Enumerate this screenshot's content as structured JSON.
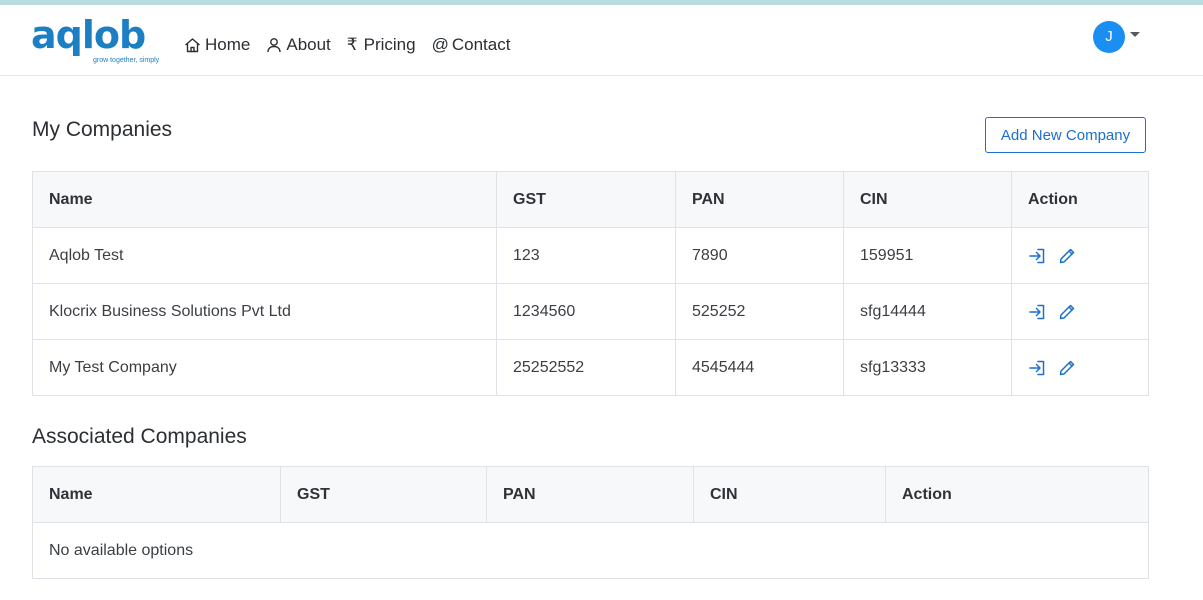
{
  "brand": {
    "name": "aqlob",
    "tagline": "grow together, simply",
    "color": "#1c7fc4"
  },
  "nav": {
    "home": "Home",
    "about": "About",
    "pricing": "Pricing",
    "contact": "Contact",
    "icons": [
      "home-icon",
      "person-icon",
      "rupee-icon",
      "at-icon"
    ]
  },
  "user": {
    "initial": "J",
    "avatar_color": "#1b8ef2"
  },
  "my_companies": {
    "title": "My Companies",
    "add_button": "Add New Company",
    "columns": [
      "Name",
      "GST",
      "PAN",
      "CIN",
      "Action"
    ],
    "rows": [
      [
        "Aqlob Test",
        "123",
        "7890",
        "159951"
      ],
      [
        "Klocrix Business Solutions Pvt Ltd",
        "1234560",
        "525252",
        "sfg14444"
      ],
      [
        "My Test Company",
        "25252552",
        "4545444",
        "sfg13333"
      ]
    ],
    "row_action_icons": [
      "login-icon",
      "edit-pencil-icon"
    ]
  },
  "associated_companies": {
    "title": "Associated Companies",
    "columns": [
      "Name",
      "GST",
      "PAN",
      "CIN",
      "Action"
    ],
    "empty_message": "No available options"
  }
}
